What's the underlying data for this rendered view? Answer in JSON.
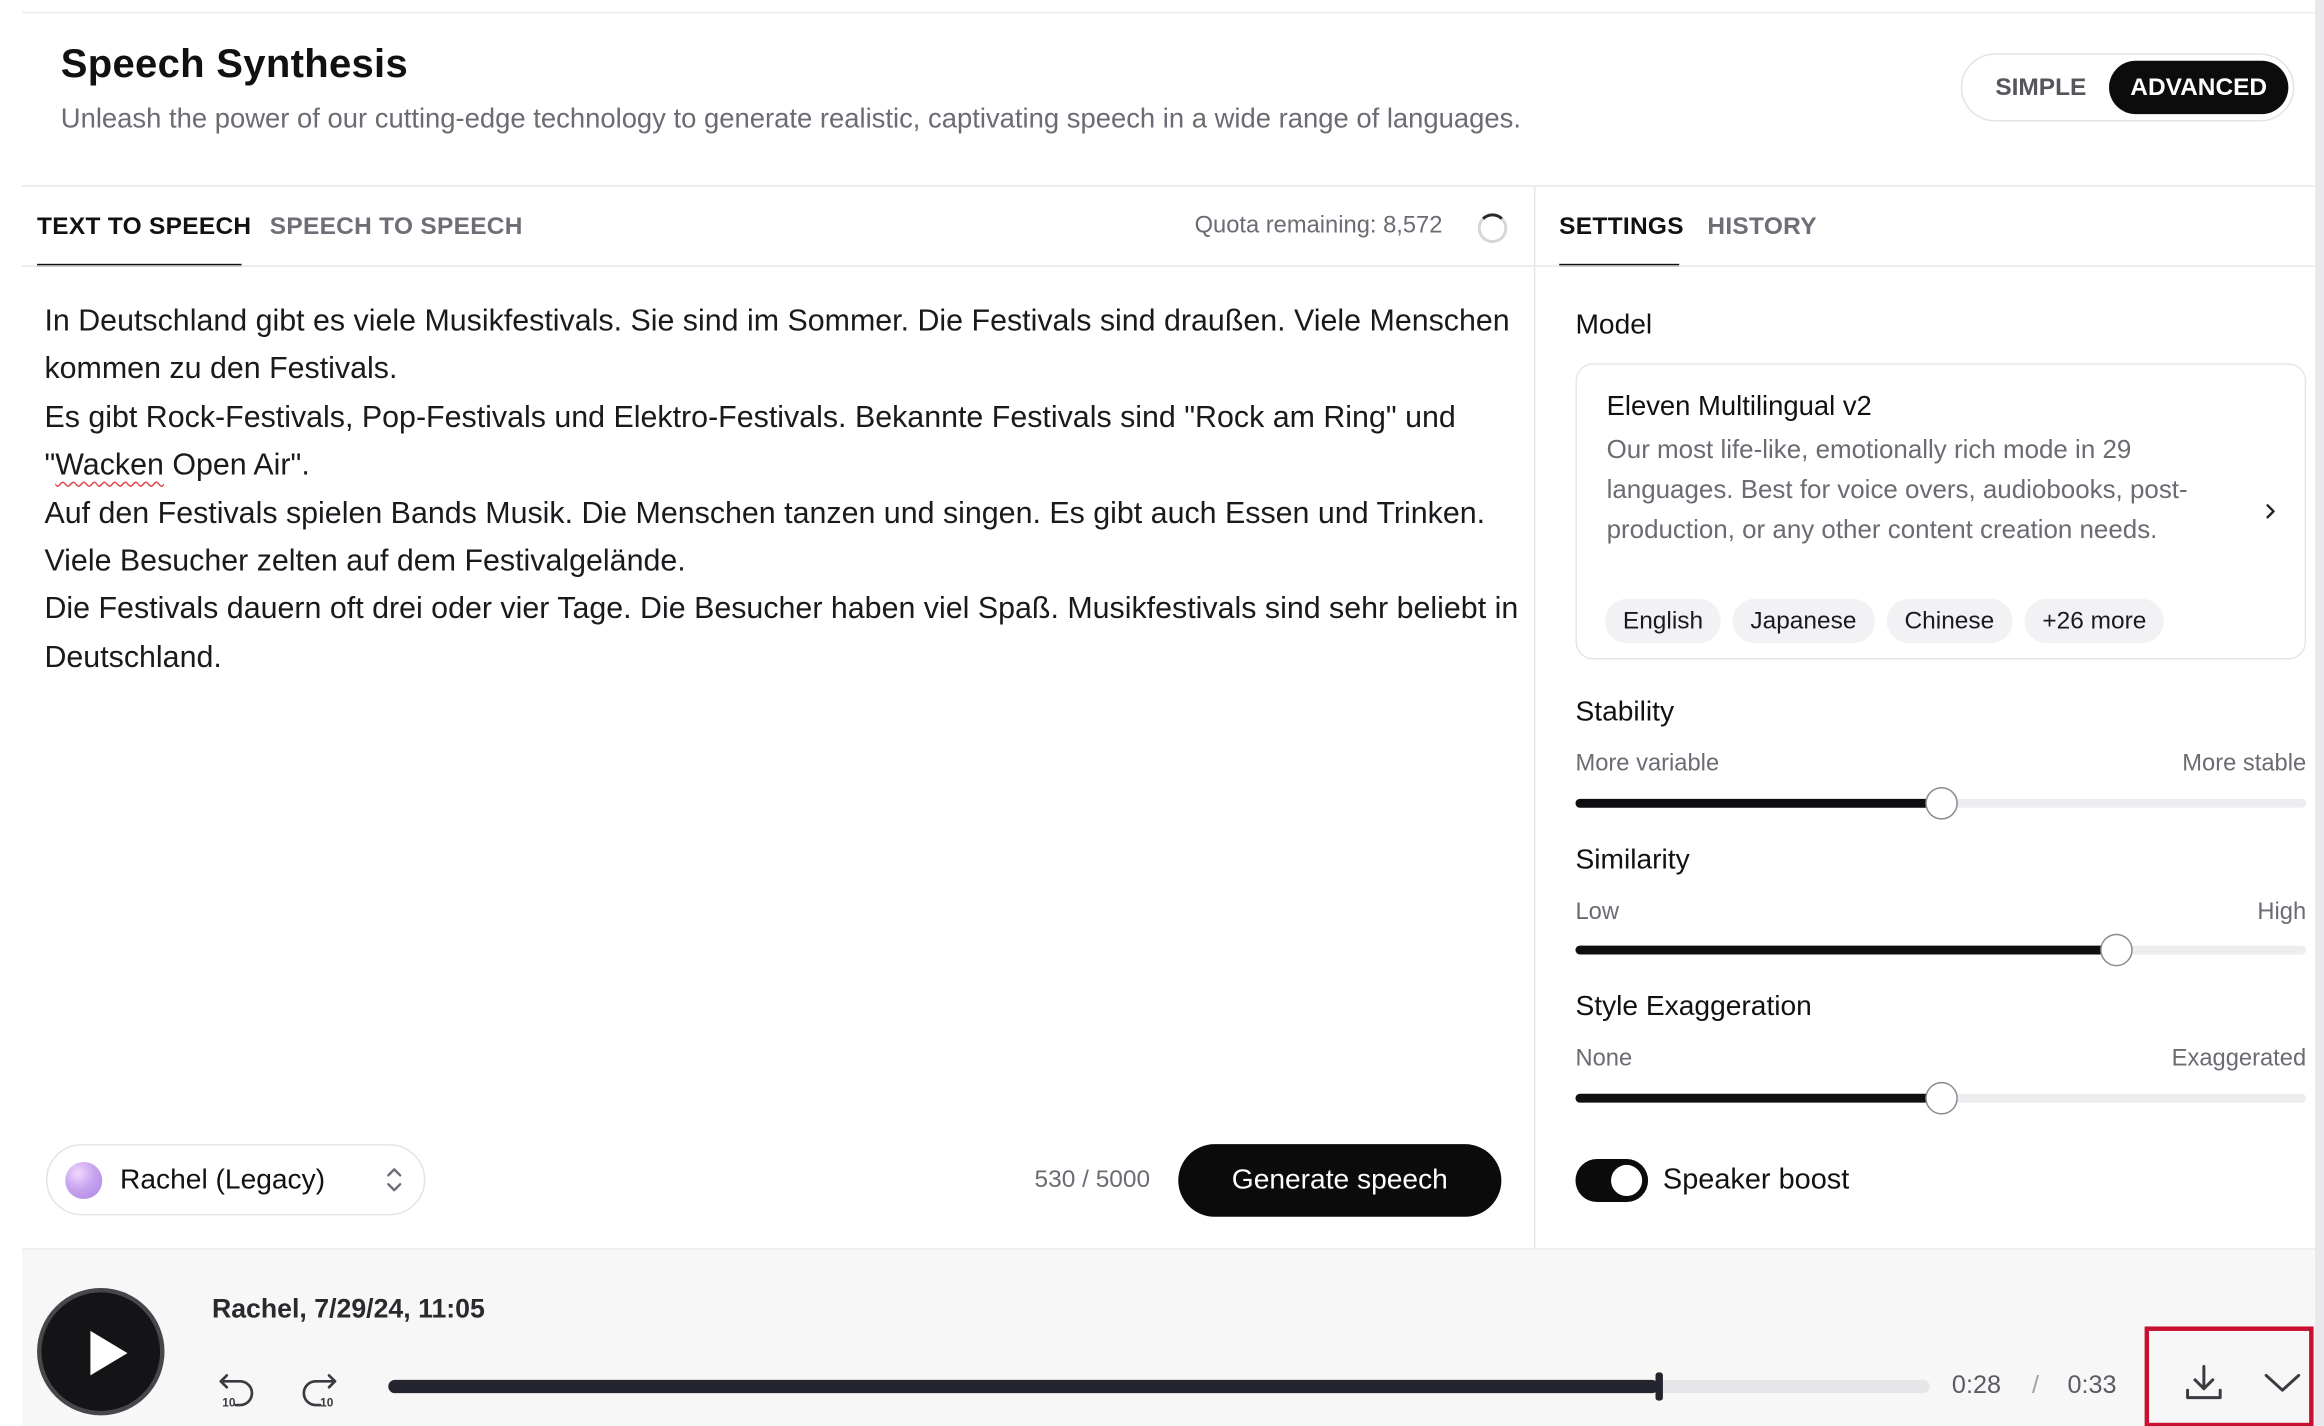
{
  "header": {
    "title": "Speech Synthesis",
    "subtitle": "Unleash the power of our cutting-edge technology to generate realistic, captivating speech in a wide range of languages.",
    "mode_simple": "SIMPLE",
    "mode_advanced": "ADVANCED",
    "active_mode": "ADVANCED"
  },
  "left_tabs": {
    "text_to_speech": "TEXT TO SPEECH",
    "speech_to_speech": "SPEECH TO SPEECH",
    "active": "TEXT TO SPEECH"
  },
  "quota": {
    "label": "Quota remaining: 8,572"
  },
  "editor": {
    "segments": [
      "In Deutschland gibt es viele Musikfestivals. Sie sind im Sommer. Die Festivals sind draußen. Viele Menschen kommen zu den Festivals.\nEs gibt Rock-Festivals, Pop-Festivals und Elektro-Festivals. Bekannte Festivals sind \"Rock am Ring\" und \"",
      "Wacken",
      " Open Air\".\nAuf den Festivals spielen Bands Musik. Die Menschen tanzen und singen. Es gibt auch Essen und Trinken. Viele Besucher zelten auf dem Festivalgelände.\nDie Festivals dauern oft drei oder vier Tage. Die Besucher haben viel Spaß. Musikfestivals sind sehr beliebt in Deutschland."
    ]
  },
  "voice": {
    "name": "Rachel (Legacy)"
  },
  "char_count": "530 / 5000",
  "generate_label": "Generate speech",
  "right_tabs": {
    "settings": "SETTINGS",
    "history": "HISTORY",
    "active": "SETTINGS"
  },
  "model": {
    "section_label": "Model",
    "name": "Eleven Multilingual v2",
    "description": "Our most life-like, emotionally rich mode in 29 languages. Best for voice overs, audiobooks, post-production, or any other content creation needs.",
    "languages": [
      "English",
      "Japanese",
      "Chinese",
      "+26 more"
    ]
  },
  "sliders": {
    "stability": {
      "label": "Stability",
      "min_label": "More variable",
      "max_label": "More stable",
      "value": 0.5
    },
    "similarity": {
      "label": "Similarity",
      "min_label": "Low",
      "max_label": "High",
      "value": 0.74
    },
    "style": {
      "label": "Style Exaggeration",
      "min_label": "None",
      "max_label": "Exaggerated",
      "value": 0.5
    }
  },
  "speaker_boost": {
    "label": "Speaker boost",
    "enabled": true
  },
  "player": {
    "title": "Rachel, 7/29/24, 11:05",
    "current_time": "0:28",
    "separator": "/",
    "duration": "0:33",
    "progress": 0.824
  },
  "icons": {
    "play": "play-icon",
    "rewind": "rewind-10-icon",
    "forward": "forward-10-icon",
    "download": "download-icon",
    "collapse": "chevron-down-icon",
    "model_arrow": "chevron-right-icon",
    "voice_select": "up-down-chevron-icon"
  },
  "colors": {
    "accent": "#0b0b0c",
    "highlight": "#c8102e",
    "muted_text": "#6b6b73"
  }
}
